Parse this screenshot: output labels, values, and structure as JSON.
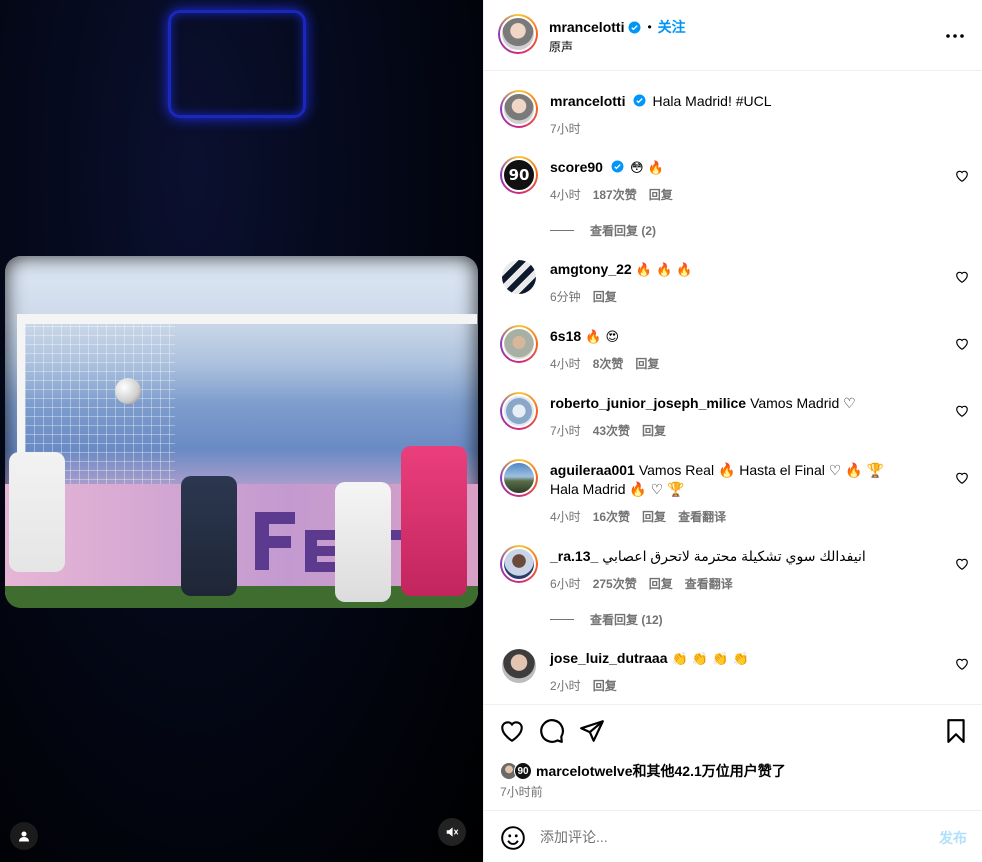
{
  "header": {
    "username": "mrancelotti",
    "separator": "•",
    "follow_label": "关注",
    "audio_label": "原声"
  },
  "caption": {
    "username": "mrancelotti",
    "text": "Hala Madrid! #UCL",
    "time": "7小时"
  },
  "comments": [
    {
      "username": "score90",
      "text": "😳 🔥",
      "time": "4小时",
      "likes": "187次赞",
      "reply": "回复",
      "view_replies": "查看回复 (2)",
      "verified": true
    },
    {
      "username": "amgtony_22",
      "text": "🔥 🔥 🔥",
      "time": "6分钟",
      "reply": "回复"
    },
    {
      "username": "6s18",
      "text": "🔥 😍",
      "time": "4小时",
      "likes": "8次赞",
      "reply": "回复"
    },
    {
      "username": "roberto_junior_joseph_milice",
      "text": "Vamos Madrid ♡",
      "time": "7小时",
      "likes": "43次赞",
      "reply": "回复"
    },
    {
      "username": "aguileraa001",
      "text": "Vamos Real 🔥  Hasta el Final ♡ 🔥 🏆  Hala Madrid 🔥 ♡ 🏆",
      "time": "4小时",
      "likes": "16次赞",
      "reply": "回复",
      "translate": "查看翻译"
    },
    {
      "username": "_ra.13_",
      "text": "انيفدالك سوي تشكيلة محترمة لاتحرق اعصابي",
      "time": "6小时",
      "likes": "275次赞",
      "reply": "回复",
      "translate": "查看翻译",
      "view_replies": "查看回复 (12)"
    },
    {
      "username": "jose_luiz_dutraaa",
      "text": "👏 👏 👏 👏",
      "time": "2小时",
      "reply": "回复"
    }
  ],
  "likes": {
    "liked_by": "marcelotwelve",
    "connector": "和",
    "others": "其他42.1万位用户",
    "suffix": "赞了",
    "time": "7小时前"
  },
  "composer": {
    "placeholder": "添加评论...",
    "post_label": "发布"
  },
  "colors": {
    "accent": "#0095f6",
    "muted": "#737373",
    "post_disabled": "#b2dffc"
  },
  "icons": [
    "more-icon",
    "verified-icon",
    "heart-icon",
    "comment-icon",
    "share-icon",
    "bookmark-icon",
    "emoji-icon",
    "user-tag-icon",
    "mute-icon"
  ]
}
